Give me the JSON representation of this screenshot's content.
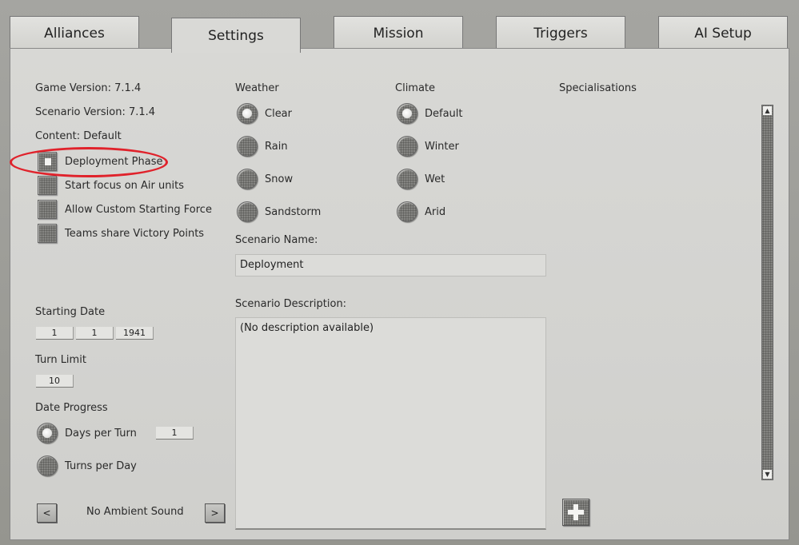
{
  "tabs": [
    {
      "label": "Alliances"
    },
    {
      "label": "Settings"
    },
    {
      "label": "Mission"
    },
    {
      "label": "Triggers"
    },
    {
      "label": "AI Setup"
    }
  ],
  "info": {
    "game_version": "Game Version: 7.1.4",
    "scenario_version": "Scenario Version: 7.1.4",
    "content": "Content: Default"
  },
  "options": [
    {
      "label": "Deployment Phase",
      "checked": true
    },
    {
      "label": "Start focus on Air units",
      "checked": false
    },
    {
      "label": "Allow Custom Starting Force",
      "checked": false
    },
    {
      "label": "Teams share Victory Points",
      "checked": false
    }
  ],
  "starting_date": {
    "label": "Starting Date",
    "day": "1",
    "month": "1",
    "year": "1941"
  },
  "turn_limit": {
    "label": "Turn Limit",
    "value": "10"
  },
  "date_progress": {
    "label": "Date Progress",
    "days_per_turn": {
      "label": "Days per Turn",
      "value": "1",
      "selected": true
    },
    "turns_per_day": {
      "label": "Turns per Day",
      "selected": false
    }
  },
  "ambient_sound": {
    "prev": "<",
    "label": "No Ambient Sound",
    "next": ">"
  },
  "weather": {
    "label": "Weather",
    "options": [
      {
        "label": "Clear",
        "selected": true
      },
      {
        "label": "Rain",
        "selected": false
      },
      {
        "label": "Snow",
        "selected": false
      },
      {
        "label": "Sandstorm",
        "selected": false
      }
    ]
  },
  "climate": {
    "label": "Climate",
    "options": [
      {
        "label": "Default",
        "selected": true
      },
      {
        "label": "Winter",
        "selected": false
      },
      {
        "label": "Wet",
        "selected": false
      },
      {
        "label": "Arid",
        "selected": false
      }
    ]
  },
  "scenario_name": {
    "label": "Scenario Name:",
    "value": "Deployment"
  },
  "scenario_description": {
    "label": "Scenario Description:",
    "value": "(No description available)"
  },
  "specialisations": {
    "label": "Specialisations"
  },
  "colors": {
    "highlight_ring": "#e0222b",
    "panel": "#d6d6d3",
    "tab": "#dcdcd9"
  }
}
